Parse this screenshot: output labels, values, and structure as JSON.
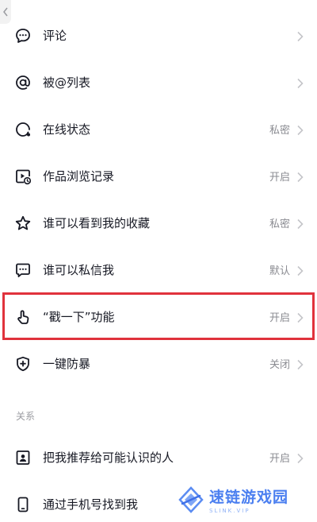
{
  "settings": {
    "items": [
      {
        "label": "评论",
        "value": ""
      },
      {
        "label": "被@列表",
        "value": ""
      },
      {
        "label": "在线状态",
        "value": "私密"
      },
      {
        "label": "作品浏览记录",
        "value": "开启"
      },
      {
        "label": "谁可以看到我的收藏",
        "value": "私密"
      },
      {
        "label": "谁可以私信我",
        "value": "默认"
      },
      {
        "label": "“戳一下”功能",
        "value": "开启"
      },
      {
        "label": "一键防暴",
        "value": "关闭"
      }
    ],
    "relations_title": "关系",
    "relations": [
      {
        "label": "把我推荐给可能认识的人",
        "value": "开启"
      },
      {
        "label": "通过手机号找到我",
        "value": ""
      }
    ]
  },
  "watermark": {
    "title": "速链游戏园",
    "subtitle": "SLINK.VIP"
  },
  "colors": {
    "highlight_border": "#e0323c",
    "watermark_blue": "#4b7ff0"
  }
}
